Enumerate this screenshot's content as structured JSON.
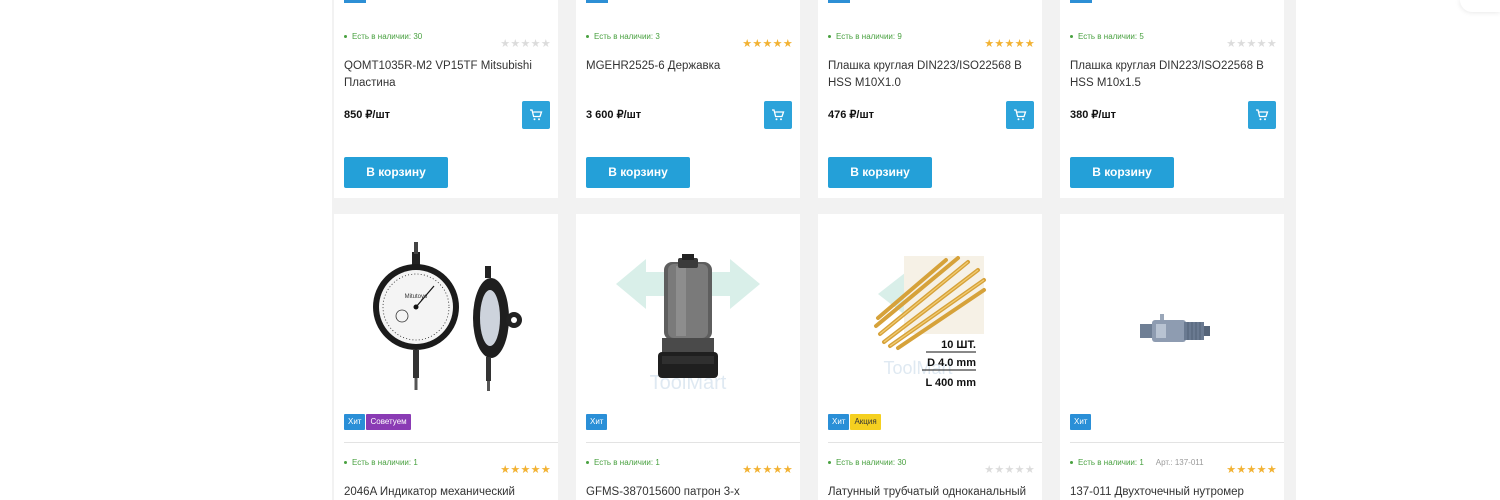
{
  "common": {
    "buy_label": "В корзину"
  },
  "colors": {
    "accent": "#24a0d8",
    "in_stock": "#49a140",
    "star": "#f2b233",
    "badge_hit": "#2a8fd7",
    "badge_recommend": "#8a3bb4",
    "badge_sale": "#f5d020"
  },
  "row1": [
    {
      "stock": "Есть в наличии: 30",
      "rating": 0,
      "title": "QOMT1035R-M2 VP15TF Mitsubishi Пластина",
      "price": "850 ₽/шт"
    },
    {
      "stock": "Есть в наличии: 3",
      "rating": 5,
      "title": "MGEHR2525-6 Державка",
      "price": "3 600 ₽/шт"
    },
    {
      "stock": "Есть в наличии: 9",
      "rating": 5,
      "title": "Плашка круглая DIN223/ISO22568 B HSS M10X1.0",
      "price": "476 ₽/шт"
    },
    {
      "stock": "Есть в наличии: 5",
      "rating": 0,
      "title": "Плашка круглая DIN223/ISO22568 B HSS M10x1.5",
      "price": "380 ₽/шт"
    }
  ],
  "row2": [
    {
      "badges": [
        "Хит",
        "Советуем"
      ],
      "stock": "Есть в наличии: 1",
      "article": "",
      "rating": 5,
      "title": "2046A Индикатор механический",
      "image": "dial-indicator"
    },
    {
      "badges": [
        "Хит"
      ],
      "stock": "Есть в наличии: 1",
      "article": "",
      "rating": 5,
      "title": "GFMS-387015600 патрон 3-х",
      "image": "drill-chuck",
      "watermark": "ToolMart"
    },
    {
      "badges": [
        "Хит",
        "Акция"
      ],
      "stock": "Есть в наличии: 30",
      "article": "",
      "rating": 0,
      "title": "Латунный трубчатый одноканальный",
      "image": "brass-tubes",
      "watermark": "ToolMart",
      "image_text": [
        "10 ШТ.",
        "D 4.0 mm",
        "L 400 mm"
      ]
    },
    {
      "badges": [
        "Хит"
      ],
      "stock": "Есть в наличии: 1",
      "article": "Арт.: 137-011",
      "rating": 5,
      "title": "137-011 Двухточечный нутромер",
      "image": "bore-micrometer"
    }
  ]
}
